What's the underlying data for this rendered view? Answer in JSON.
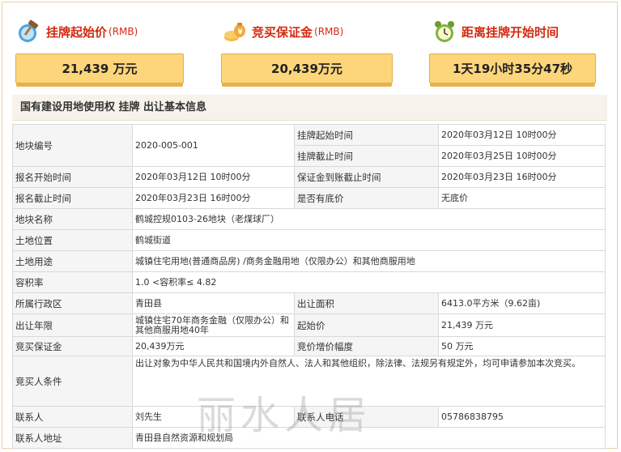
{
  "headers": {
    "start_price": {
      "title": "挂牌起始价",
      "unit": "(RMB)",
      "value": "21,439  万元"
    },
    "deposit": {
      "title": "竞买保证金",
      "unit": "(RMB)",
      "value": "20,439万元"
    },
    "countdown": {
      "title": "距离挂牌开始时间",
      "value": "1天19小时35分47秒"
    }
  },
  "section_title": "国有建设用地使用权 挂牌 出让基本信息",
  "info": {
    "parcel_no_label": "地块编号",
    "parcel_no": "2020-005-001",
    "listing_start_label": "挂牌起始时间",
    "listing_start": "2020年03月12日 10时00分",
    "listing_end_label": "挂牌截止时间",
    "listing_end": "2020年03月25日 10时00分",
    "reg_start_label": "报名开始时间",
    "reg_start": "2020年03月12日 10时00分",
    "deposit_deadline_label": "保证金到账截止时间",
    "deposit_deadline": "2020年03月23日 16时00分",
    "reg_end_label": "报名截止时间",
    "reg_end": "2020年03月23日 16时00分",
    "reserve_label": "是否有底价",
    "reserve": "无底价",
    "parcel_name_label": "地块名称",
    "parcel_name": "鹤城控规0103-26地块（老煤球厂）",
    "location_label": "土地位置",
    "location": "鹤城街道",
    "usage_label": "土地用途",
    "usage": "城镇住宅用地(普通商品房) /商务金融用地（仅限办公）和其他商服用地",
    "far_label": "容积率",
    "far": "1.0 <容积率≤ 4.82",
    "district_label": "所属行政区",
    "district": "青田县",
    "area_label": "出让面积",
    "area": "6413.0平方米（9.62亩)",
    "term_label": "出让年限",
    "term": "城镇住宅70年商务金融（仅限办公）和其他商服用地40年",
    "start_price_label": "起始价",
    "start_price": "21,439 万元",
    "deposit_label": "竞买保证金",
    "deposit": "20,439万元",
    "increment_label": "竞价增价幅度",
    "increment": "50 万元",
    "conditions_label": "竞买人条件",
    "conditions": "出让对象为中华人民共和国境内外自然人、法人和其他组织，除法律、法规另有规定外，均可申请参加本次竞买。",
    "contact_label": "联系人",
    "contact": "刘先生",
    "phone_label": "联系人电话",
    "phone": "05786838795",
    "address_label": "联系人地址",
    "address": "青田县自然资源和规划局"
  },
  "watermark": "丽水人居",
  "icons": [
    "auction-hammer-icon",
    "money-bag-icon",
    "alarm-clock-icon"
  ],
  "colors": {
    "accent_red": "#d42a10",
    "box_bg": "#fdd57b",
    "box_border": "#e2ad4c"
  }
}
